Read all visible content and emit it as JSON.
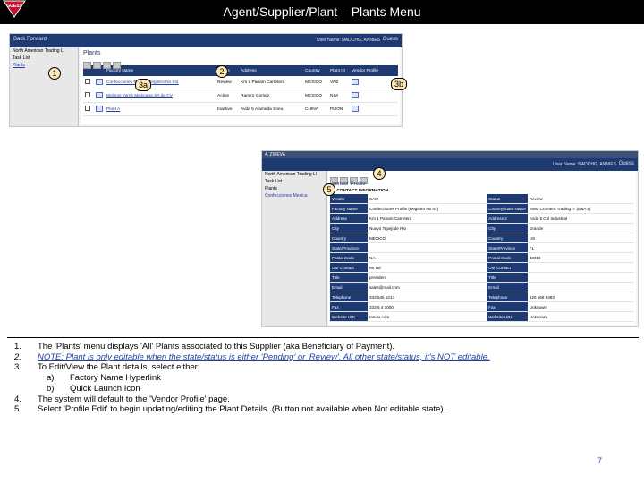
{
  "header": {
    "title": "Agent/Supplier/Plant – Plants Menu",
    "logo_text": "GUESS"
  },
  "screen1": {
    "nav_text": "Back  Forward",
    "user_text": "User Name: NADCHG, ANNIES",
    "brand": "Guess",
    "sidebar": [
      "North American Trading Ll",
      "Task List",
      "Plants"
    ],
    "page_title": "Plants",
    "columns": [
      "",
      "",
      "Factory Name",
      "Status",
      "Address",
      "Country",
      "Plant ID",
      "Vendor Profile"
    ],
    "rows": [
      {
        "name": "Confecciones Profile (Registro No 04)",
        "status": "Review",
        "address": "Km 1 Panam Carretera",
        "country": "MEXICO",
        "id": "VN2"
      },
      {
        "name": "Molinos Yarns Mexicana SA de CV",
        "status": "Active",
        "address": "Ramiro Gomez",
        "country": "MEXICO",
        "id": "NIM"
      },
      {
        "name": "Plant A",
        "status": "Inactive",
        "address": "Avda 5 Alameda Sneu",
        "country": "CHINA",
        "id": "PLION"
      }
    ]
  },
  "screen2": {
    "window_title": "4, ZWEVA",
    "user_text": "User Name: NADCHG, ANNIES",
    "brand": "Guess",
    "sidebar": [
      "North American Trading Ll",
      "Task List",
      "Plants",
      "Confecciones Mexica"
    ],
    "profile_title": "Vendor Profile",
    "section": "1. CONTACT INFORMATION",
    "rows": [
      {
        "l1": "Vendor",
        "v1": "SAM",
        "l2": "Status",
        "v2": "Review"
      },
      {
        "l1": "Factory Name",
        "v1": "Confecciones Profile (Registro No 04)",
        "l2": "Country/State Name",
        "v2": "SWB Cromera Trading IT (B&A 4)"
      },
      {
        "l1": "Address",
        "v1": "Km 1 Panam Carretera",
        "l2": "Address 2",
        "v2": "Avda 5 Col Industrial"
      },
      {
        "l1": "City",
        "v1": "Nuevo Tepeji de Rio",
        "l2": "City",
        "v2": "Grande"
      },
      {
        "l1": "Country",
        "v1": "MEXICO",
        "l2": "Country",
        "v2": "US"
      },
      {
        "l1": "State/Province",
        "v1": "",
        "l2": "State/Province",
        "v2": "FL"
      },
      {
        "l1": "Postal Code",
        "v1": "NA",
        "l2": "Postal Code",
        "v2": "32319"
      },
      {
        "l1": "Our Contact",
        "v1": "Mr Nd",
        "l2": "Our Contact",
        "v2": ""
      },
      {
        "l1": "Title",
        "v1": "president",
        "l2": "Title",
        "v2": ""
      },
      {
        "l1": "Email",
        "v1": "sales@mail.com",
        "l2": "Email",
        "v2": ""
      },
      {
        "l1": "Telephone",
        "v1": "333 545 5214",
        "l2": "Telephone",
        "v2": "520 568 9383"
      },
      {
        "l1": "Fax",
        "v1": "333 5 4 3000",
        "l2": "Fax",
        "v2": "Unknown"
      },
      {
        "l1": "Website URL",
        "v1": "tarwia.com",
        "l2": "Website URL",
        "v2": "Unknown"
      }
    ]
  },
  "callouts": {
    "c1": "1",
    "c2": "2",
    "c3a": "3a",
    "c3b": "3b",
    "c4": "4",
    "c5": "5"
  },
  "notes": {
    "n1_num": "1.",
    "n1": "The 'Plants' menu displays 'All' Plants associated to this Supplier (aka Beneficiary of Payment).",
    "n2_num": "2.",
    "n2": "NOTE: Plant is only editable when the state/status is either 'Pending' or 'Review'.  All other state/status, it's NOT editable.",
    "n3_num": "3.",
    "n3": "To Edit/View the Plant details, select either:",
    "n3a_lt": "a)",
    "n3a": "Factory Name Hyperlink",
    "n3b_lt": "b)",
    "n3b": "Quick Launch Icon",
    "n4_num": "4.",
    "n4": "The system will default to the 'Vendor Profile' page.",
    "n5_num": "5.",
    "n5": "Select 'Profile Edit' to begin updating/editing the Plant Details.  (Button not available when Not editable state)."
  },
  "page_number": "7"
}
